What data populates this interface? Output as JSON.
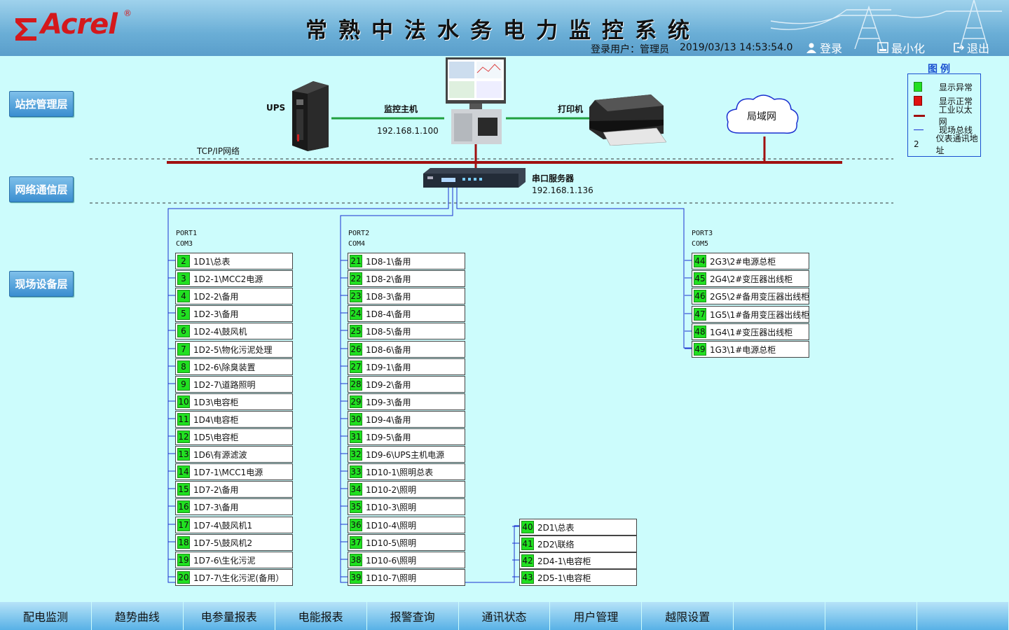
{
  "header": {
    "logo_text": "Acrel",
    "logo_reg": "®",
    "title": "常熟中法水务电力监控系统",
    "user_label": "登录用户：管理员",
    "datetime": "2019/03/13  14:53:54.0",
    "login": "登录",
    "minimize": "最小化",
    "exit": "退出"
  },
  "layers": [
    "站控管理层",
    "网络通信层",
    "现场设备层"
  ],
  "topology": {
    "ups": "UPS",
    "host": "监控主机",
    "host_ip": "192.168.1.100",
    "printer": "打印机",
    "lan": "局域网",
    "tcpip": "TCP/IP网络",
    "serial_server": "串口服务器",
    "serial_ip": "192.168.1.136"
  },
  "legend": {
    "title": "图例",
    "items": [
      {
        "label": "显示异常",
        "color": "#21e021"
      },
      {
        "label": "显示正常",
        "color": "#e01010"
      },
      {
        "label": "工业以太网",
        "color": "#a01010"
      },
      {
        "label": "现场总线",
        "color": "#1a30d0"
      },
      {
        "label": "仪表通讯地址",
        "symbol": "2"
      }
    ]
  },
  "ports": [
    {
      "port": "PORT1",
      "com": "COM3"
    },
    {
      "port": "PORT2",
      "com": "COM4"
    },
    {
      "port": "PORT3",
      "com": "COM5"
    }
  ],
  "devices_port1": [
    {
      "num": "2",
      "name": "1D1\\总表"
    },
    {
      "num": "3",
      "name": "1D2-1\\MCC2电源"
    },
    {
      "num": "4",
      "name": "1D2-2\\备用"
    },
    {
      "num": "5",
      "name": "1D2-3\\备用"
    },
    {
      "num": "6",
      "name": "1D2-4\\鼓风机"
    },
    {
      "num": "7",
      "name": "1D2-5\\物化污泥处理"
    },
    {
      "num": "8",
      "name": "1D2-6\\除臭装置"
    },
    {
      "num": "9",
      "name": "1D2-7\\道路照明"
    },
    {
      "num": "10",
      "name": "1D3\\电容柜"
    },
    {
      "num": "11",
      "name": "1D4\\电容柜"
    },
    {
      "num": "12",
      "name": "1D5\\电容柜"
    },
    {
      "num": "13",
      "name": "1D6\\有源滤波"
    },
    {
      "num": "14",
      "name": "1D7-1\\MCC1电源"
    },
    {
      "num": "15",
      "name": "1D7-2\\备用"
    },
    {
      "num": "16",
      "name": "1D7-3\\备用"
    },
    {
      "num": "17",
      "name": "1D7-4\\鼓风机1"
    },
    {
      "num": "18",
      "name": "1D7-5\\鼓风机2"
    },
    {
      "num": "19",
      "name": "1D7-6\\生化污泥"
    },
    {
      "num": "20",
      "name": "1D7-7\\生化污泥(备用）"
    }
  ],
  "devices_port2": [
    {
      "num": "21",
      "name": "1D8-1\\备用"
    },
    {
      "num": "22",
      "name": "1D8-2\\备用"
    },
    {
      "num": "23",
      "name": "1D8-3\\备用"
    },
    {
      "num": "24",
      "name": "1D8-4\\备用"
    },
    {
      "num": "25",
      "name": "1D8-5\\备用"
    },
    {
      "num": "26",
      "name": "1D8-6\\备用"
    },
    {
      "num": "27",
      "name": "1D9-1\\备用"
    },
    {
      "num": "28",
      "name": "1D9-2\\备用"
    },
    {
      "num": "29",
      "name": "1D9-3\\备用"
    },
    {
      "num": "30",
      "name": "1D9-4\\备用"
    },
    {
      "num": "31",
      "name": "1D9-5\\备用"
    },
    {
      "num": "32",
      "name": "1D9-6\\UPS主机电源"
    },
    {
      "num": "33",
      "name": "1D10-1\\照明总表"
    },
    {
      "num": "34",
      "name": "1D10-2\\照明"
    },
    {
      "num": "35",
      "name": "1D10-3\\照明"
    },
    {
      "num": "36",
      "name": "1D10-4\\照明"
    },
    {
      "num": "37",
      "name": "1D10-5\\照明"
    },
    {
      "num": "38",
      "name": "1D10-6\\照明"
    },
    {
      "num": "39",
      "name": "1D10-7\\照明"
    }
  ],
  "devices_port2b": [
    {
      "num": "40",
      "name": "2D1\\总表"
    },
    {
      "num": "41",
      "name": "2D2\\联络"
    },
    {
      "num": "42",
      "name": "2D4-1\\电容柜"
    },
    {
      "num": "43",
      "name": "2D5-1\\电容柜"
    }
  ],
  "devices_port3": [
    {
      "num": "44",
      "name": "2G3\\2#电源总柜"
    },
    {
      "num": "45",
      "name": "2G4\\2#变压器出线柜"
    },
    {
      "num": "46",
      "name": "2G5\\2#备用变压器出线柜"
    },
    {
      "num": "47",
      "name": "1G5\\1#备用变压器出线柜"
    },
    {
      "num": "48",
      "name": "1G4\\1#变压器出线柜"
    },
    {
      "num": "49",
      "name": "1G3\\1#电源总柜"
    }
  ],
  "nav": [
    "配电监测",
    "趋势曲线",
    "电参量报表",
    "电能报表",
    "报警查询",
    "通讯状态",
    "用户管理",
    "越限设置",
    "",
    "",
    ""
  ]
}
